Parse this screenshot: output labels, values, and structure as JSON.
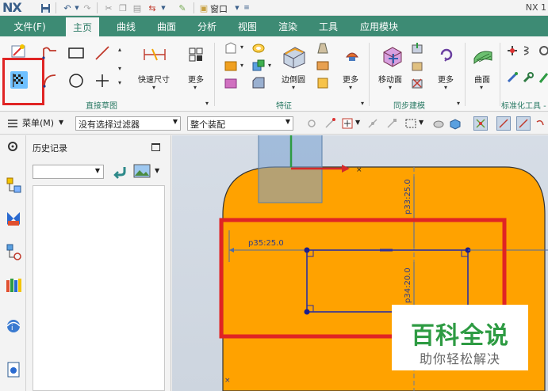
{
  "titlebar": {
    "logo": "NX",
    "window_menu": "窗口",
    "title_right": "NX 1"
  },
  "tabs": {
    "file": "文件(F)",
    "items": [
      "主页",
      "曲线",
      "曲面",
      "分析",
      "视图",
      "渲染",
      "工具",
      "应用模块"
    ],
    "active": "主页"
  },
  "ribbon": {
    "sketch_group": {
      "label": "直接草图",
      "quick_dimension": "快速尺寸",
      "more": "更多"
    },
    "feature_group": {
      "label": "特征",
      "edge_blend": "边倒圆",
      "more": "更多"
    },
    "sync_group": {
      "label": "同步建模",
      "move_face": "移动面",
      "more": "更多"
    },
    "surface_group": {
      "surface": "曲面"
    },
    "standard_group": {
      "label": "标准化工具 -"
    }
  },
  "filterbar": {
    "menu": "菜单(M)",
    "selection_filter": "没有选择过滤器",
    "assembly_scope": "整个装配"
  },
  "history_panel": {
    "title": "历史记录"
  },
  "canvas": {
    "dim_p35": "p35:25.0",
    "dim_p33": "p33:25.0",
    "dim_p34": "p34:20.0"
  },
  "watermark": {
    "title": "百科全说",
    "subtitle": "助你轻松解决"
  },
  "colors": {
    "part_fill": "#ffa200",
    "sketch_line": "#2b2fa0",
    "highlight": "#e02424",
    "tab_bar": "#3d8b74"
  }
}
